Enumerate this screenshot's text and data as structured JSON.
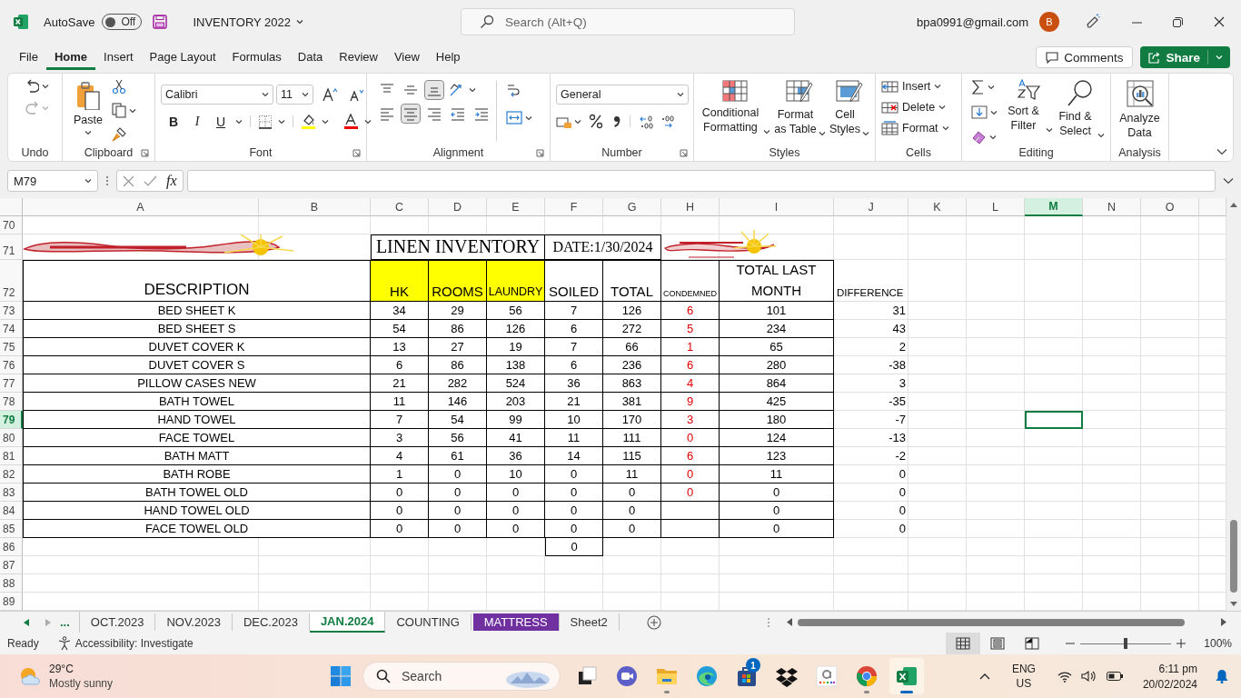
{
  "title_bar": {
    "autosave": {
      "label": "AutoSave",
      "state": "Off",
      "on": false
    },
    "file_name": "INVENTORY 2022",
    "search": {
      "placeholder": "Search (Alt+Q)"
    },
    "account": "bpa0991@gmail.com",
    "avatar": "B"
  },
  "menu_tabs": [
    {
      "label": "File",
      "selected": false
    },
    {
      "label": "Home",
      "selected": true
    },
    {
      "label": "Insert",
      "selected": false
    },
    {
      "label": "Page Layout",
      "selected": false
    },
    {
      "label": "Formulas",
      "selected": false
    },
    {
      "label": "Data",
      "selected": false
    },
    {
      "label": "Review",
      "selected": false
    },
    {
      "label": "View",
      "selected": false
    },
    {
      "label": "Help",
      "selected": false
    }
  ],
  "header_buttons": {
    "comments": "Comments",
    "share": "Share"
  },
  "ribbon": [
    {
      "kind": "undo",
      "label": "Undo"
    },
    {
      "kind": "clipboard",
      "label": "Clipboard",
      "buttons": [
        "Paste"
      ]
    },
    {
      "kind": "font",
      "label": "Font",
      "font_name": "Calibri",
      "font_size": "11",
      "style_buttons": [
        "B",
        "I",
        "U"
      ]
    },
    {
      "kind": "alignment",
      "label": "Alignment",
      "vertical": [
        {
          "kind": "top",
          "selected": false
        },
        {
          "kind": "middle",
          "selected": false
        },
        {
          "kind": "bottom",
          "selected": true
        }
      ],
      "horizontal": [
        {
          "kind": "left",
          "selected": false
        },
        {
          "kind": "center",
          "selected": true
        },
        {
          "kind": "right",
          "selected": false
        },
        {
          "kind": "indent_less",
          "selected": false
        },
        {
          "kind": "indent_more",
          "selected": false
        }
      ]
    },
    {
      "kind": "number",
      "label": "Number",
      "format": "General"
    },
    {
      "kind": "large_buttons",
      "label": "Styles",
      "buttons": [
        "Conditional Formatting",
        "Format as Table",
        "Cell Styles"
      ]
    },
    {
      "kind": "cells",
      "label": "Cells",
      "buttons": [
        "Insert",
        "Delete",
        "Format"
      ]
    },
    {
      "kind": "editing",
      "label": "Editing",
      "buttons": [
        "Sort & Filter",
        "Find & Select"
      ]
    },
    {
      "kind": "analysis",
      "label": "Analysis",
      "buttons": [
        "Analyze Data"
      ]
    }
  ],
  "formula_bar": {
    "name_box": "M79",
    "function_label": "fx"
  },
  "sheet": {
    "column_headers": [
      {
        "label": "A",
        "selected": false
      },
      {
        "label": "B",
        "selected": false
      },
      {
        "label": "C",
        "selected": false
      },
      {
        "label": "D",
        "selected": false
      },
      {
        "label": "E",
        "selected": false
      },
      {
        "label": "F",
        "selected": false
      },
      {
        "label": "G",
        "selected": false
      },
      {
        "label": "H",
        "selected": false
      },
      {
        "label": "I",
        "selected": false
      },
      {
        "label": "J",
        "selected": false
      },
      {
        "label": "K",
        "selected": false
      },
      {
        "label": "L",
        "selected": false
      },
      {
        "label": "M",
        "selected": true
      },
      {
        "label": "N",
        "selected": false
      },
      {
        "label": "O",
        "selected": false
      }
    ],
    "row_headers": [
      {
        "label": "70",
        "selected": false
      },
      {
        "label": "71",
        "selected": false
      },
      {
        "label": "72",
        "selected": false
      },
      {
        "label": "73",
        "selected": false
      },
      {
        "label": "74",
        "selected": false
      },
      {
        "label": "75",
        "selected": false
      },
      {
        "label": "76",
        "selected": false
      },
      {
        "label": "77",
        "selected": false
      },
      {
        "label": "78",
        "selected": false
      },
      {
        "label": "79",
        "selected": true
      },
      {
        "label": "80",
        "selected": false
      },
      {
        "label": "81",
        "selected": false
      },
      {
        "label": "82",
        "selected": false
      },
      {
        "label": "83",
        "selected": false
      },
      {
        "label": "84",
        "selected": false
      },
      {
        "label": "85",
        "selected": false
      },
      {
        "label": "86",
        "selected": false
      },
      {
        "label": "87",
        "selected": false
      },
      {
        "label": "88",
        "selected": false
      },
      {
        "label": "89",
        "selected": false
      }
    ],
    "title": "LINEN INVENTORY",
    "date": "DATE:1/30/2024",
    "columns": [
      {
        "label": "DESCRIPTION",
        "highlighted": false
      },
      {
        "label": "HK",
        "highlighted": true
      },
      {
        "label": "ROOMS",
        "highlighted": true
      },
      {
        "label": "LAUNDRY",
        "highlighted": true
      },
      {
        "label": "SOILED",
        "highlighted": false
      },
      {
        "label": "TOTAL",
        "highlighted": false
      },
      {
        "label": "CONDEMNED",
        "highlighted": false
      },
      {
        "label": "TOTAL LAST MONTH",
        "highlighted": false
      },
      {
        "label": "DIFFERENCE",
        "highlighted": false
      }
    ],
    "rows": [
      [
        "BED SHEET K",
        "34",
        "29",
        "56",
        "7",
        "126",
        "6",
        "101",
        "31"
      ],
      [
        "BED SHEET S",
        "54",
        "86",
        "126",
        "6",
        "272",
        "5",
        "234",
        "43"
      ],
      [
        "DUVET COVER K",
        "13",
        "27",
        "19",
        "7",
        "66",
        "1",
        "65",
        "2"
      ],
      [
        "DUVET COVER S",
        "6",
        "86",
        "138",
        "6",
        "236",
        "6",
        "280",
        "-38"
      ],
      [
        "PILLOW CASES NEW",
        "21",
        "282",
        "524",
        "36",
        "863",
        "4",
        "864",
        "3"
      ],
      [
        "BATH TOWEL",
        "11",
        "146",
        "203",
        "21",
        "381",
        "9",
        "425",
        "-35"
      ],
      [
        "HAND TOWEL",
        "7",
        "54",
        "99",
        "10",
        "170",
        "3",
        "180",
        "-7"
      ],
      [
        "FACE TOWEL",
        "3",
        "56",
        "41",
        "11",
        "111",
        "0",
        "124",
        "-13"
      ],
      [
        "BATH MATT",
        "4",
        "61",
        "36",
        "14",
        "115",
        "6",
        "123",
        "-2"
      ],
      [
        "BATH ROBE",
        "1",
        "0",
        "10",
        "0",
        "11",
        "0",
        "11",
        "0"
      ],
      [
        "BATH TOWEL OLD",
        "0",
        "0",
        "0",
        "0",
        "0",
        "0",
        "0",
        "0"
      ],
      [
        "HAND TOWEL OLD",
        "0",
        "0",
        "0",
        "0",
        "0",
        null,
        "0",
        "0"
      ],
      [
        "FACE TOWEL OLD",
        "0",
        "0",
        "0",
        "0",
        "0",
        null,
        "0",
        "0"
      ]
    ],
    "soiled_total": "0"
  },
  "sheet_tabs": {
    "overflow": "...",
    "tabs": [
      {
        "label": "OCT.2023",
        "selected": false
      },
      {
        "label": "NOV.2023",
        "selected": false
      },
      {
        "label": "DEC.2023",
        "selected": false
      },
      {
        "label": "JAN.2024",
        "selected": true
      },
      {
        "label": "COUNTING",
        "selected": false
      },
      {
        "label": "MATTRESS",
        "selected": false,
        "color": "#7030a0"
      },
      {
        "label": "Sheet2",
        "selected": false
      }
    ]
  },
  "status_bar": {
    "mode": "Ready",
    "accessibility": "Accessibility: Investigate",
    "views": [
      {
        "kind": "normal",
        "selected": true
      },
      {
        "kind": "page_layout",
        "selected": false
      },
      {
        "kind": "page_break",
        "selected": false
      }
    ],
    "zoom": {
      "level": 0.5,
      "reading": "100%"
    }
  },
  "taskbar": {
    "weather": {
      "temperature": "29°C",
      "condition": "Mostly sunny"
    },
    "search_placeholder": "Search",
    "apps": [
      {
        "kind": "task_view",
        "running": false,
        "active": false
      },
      {
        "kind": "meet",
        "running": false,
        "active": false
      },
      {
        "kind": "explorer",
        "running": true,
        "active": false
      },
      {
        "kind": "edge",
        "running": false,
        "active": false
      },
      {
        "kind": "store",
        "running": false,
        "active": false,
        "badge": "1"
      },
      {
        "kind": "dropbox",
        "running": false,
        "active": false
      },
      {
        "kind": "amazon",
        "running": false,
        "active": false
      },
      {
        "kind": "chrome",
        "running": true,
        "active": false
      },
      {
        "kind": "excel",
        "running": true,
        "active": true
      }
    ],
    "language": "ENG",
    "region": "US",
    "time": "6:11 pm",
    "date": "20/02/2024"
  }
}
